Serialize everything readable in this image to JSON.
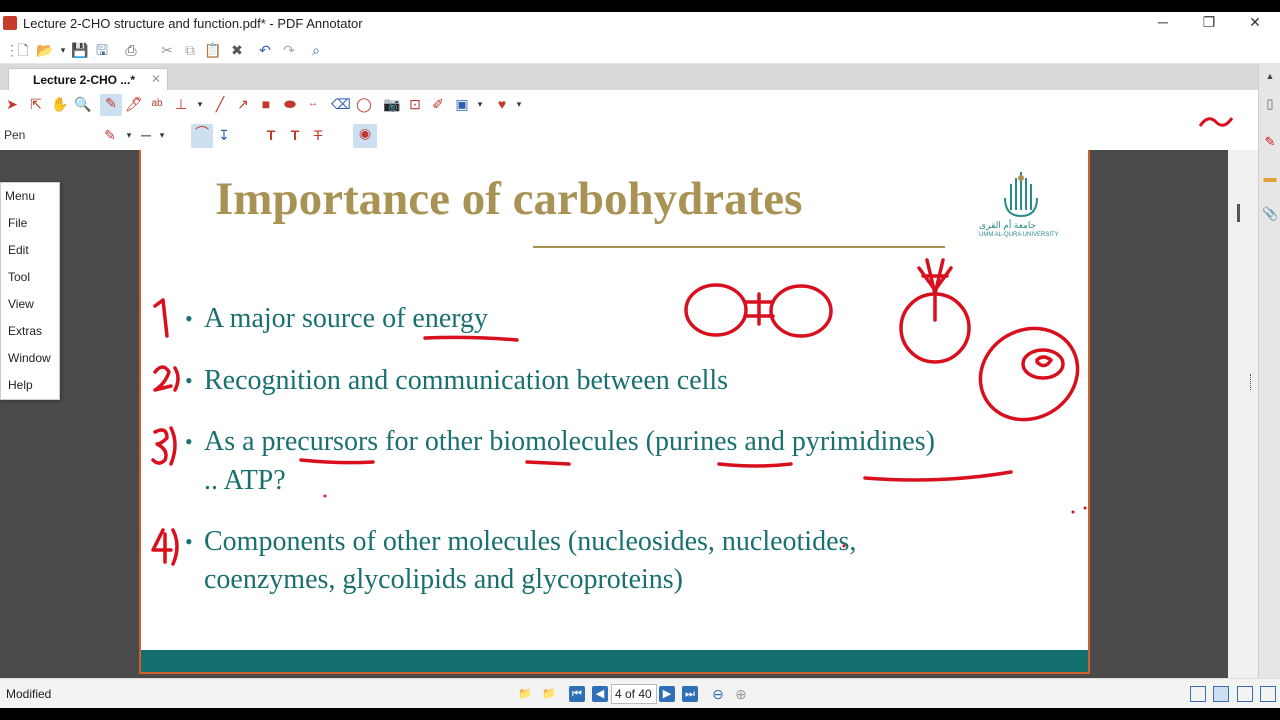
{
  "window": {
    "title": "Lecture 2-CHO structure and function.pdf* - PDF Annotator",
    "minimize": "─",
    "maximize": "❐",
    "close": "✕"
  },
  "tab": {
    "label": "Lecture 2-CHO ...*",
    "close": "✕"
  },
  "toolbar": {
    "tool_label": "Pen"
  },
  "menu": {
    "title": "Menu",
    "items": [
      "File",
      "Edit",
      "Tool",
      "View",
      "Extras",
      "Window",
      "Help"
    ]
  },
  "slide": {
    "title": "Importance of carbohydrates",
    "bullets": [
      "A major source of energy",
      "Recognition and communication between cells",
      "As a precursors for other biomolecules (purines and pyrimidines)",
      ".. ATP?",
      "Components of other molecules (nucleosides,  nucleotides,",
      "coenzymes, glycolipids and glycoproteins)"
    ],
    "bullet_symbol": "•",
    "logo_text_ar": "جامعة أم القرى",
    "logo_text_en": "UMM AL-QURA UNIVERSITY"
  },
  "status": {
    "text": "Modified",
    "page_display": "4 of 40"
  },
  "colors": {
    "title_gold": "#a89254",
    "body_teal": "#1a6f6f",
    "ink_red": "#d8101e",
    "band_teal": "#14706f"
  }
}
